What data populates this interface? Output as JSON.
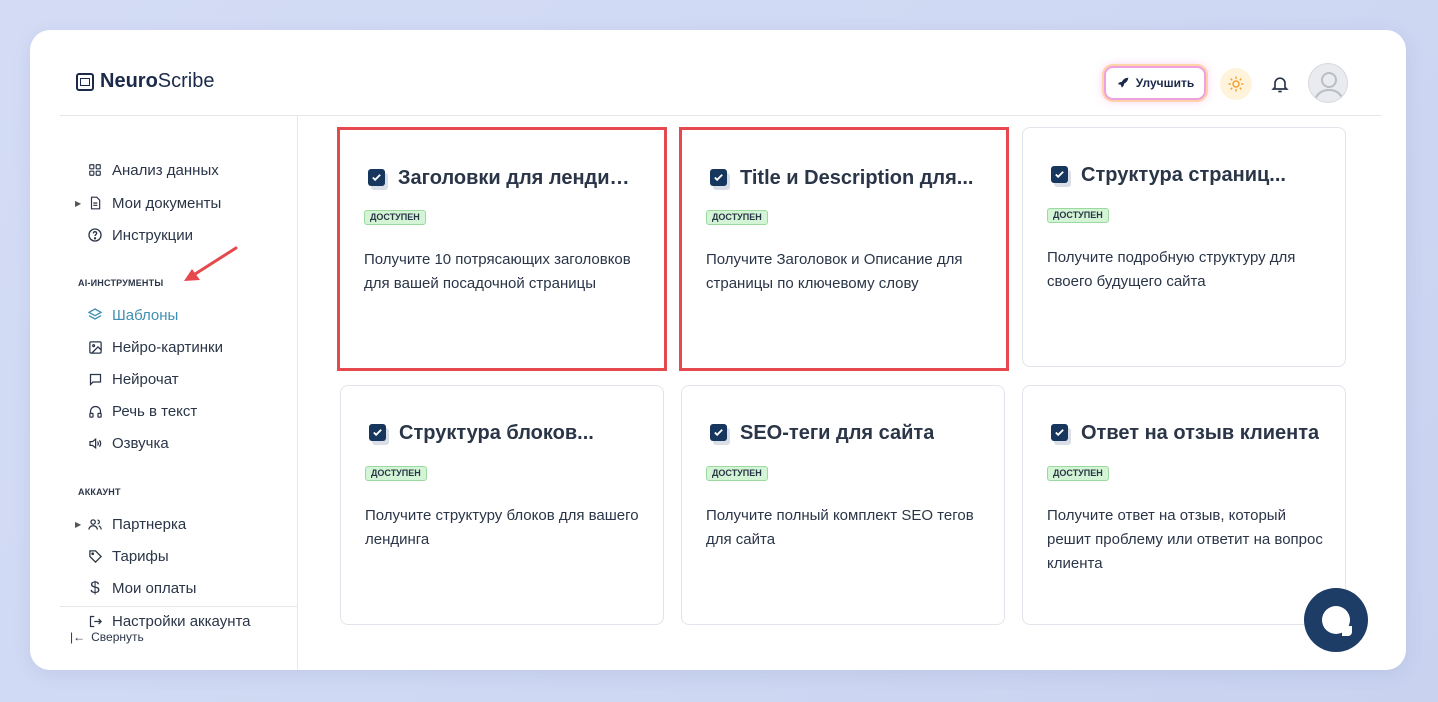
{
  "header": {
    "logo_bold": "Neuro",
    "logo_light": "Scribe",
    "upgrade_label": "Улучшить"
  },
  "sidebar": {
    "top_items": [
      {
        "label": "Анализ данных",
        "icon": "grid-icon"
      },
      {
        "label": "Мои документы",
        "icon": "document-icon"
      },
      {
        "label": "Инструкции",
        "icon": "help-circle-icon"
      }
    ],
    "section_ai": "AI-ИНСТРУМЕНТЫ",
    "ai_items": [
      {
        "label": "Шаблоны",
        "icon": "layers-icon",
        "active": true
      },
      {
        "label": "Нейро-картинки",
        "icon": "image-icon"
      },
      {
        "label": "Нейрочат",
        "icon": "chat-icon"
      },
      {
        "label": "Речь в текст",
        "icon": "headphones-icon"
      },
      {
        "label": "Озвучка",
        "icon": "speaker-icon"
      }
    ],
    "section_account": "АККАУНТ",
    "account_items": [
      {
        "label": "Партнерка",
        "icon": "users-icon"
      },
      {
        "label": "Тарифы",
        "icon": "tag-icon"
      },
      {
        "label": "Мои оплаты",
        "icon": "dollar-icon"
      },
      {
        "label": "Настройки аккаунта",
        "icon": "logout-icon"
      }
    ],
    "collapse_label": "Свернуть"
  },
  "cards": [
    {
      "title": "Заголовки для лендинга",
      "badge": "ДОСТУПЕН",
      "desc": "Получите 10 потрясающих заголовков для вашей посадочной страницы",
      "highlighted": true
    },
    {
      "title": "Title и Description для...",
      "badge": "ДОСТУПЕН",
      "desc": "Получите Заголовок и Описание для страницы по ключевому слову",
      "highlighted": true
    },
    {
      "title": "Структура страниц...",
      "badge": "ДОСТУПЕН",
      "desc": "Получите подробную структуру для своего будущего сайта",
      "highlighted": false
    },
    {
      "title": "Структура блоков...",
      "badge": "ДОСТУПЕН",
      "desc": "Получите структуру блоков для вашего лендинга",
      "highlighted": false
    },
    {
      "title": "SEO-теги для сайта",
      "badge": "ДОСТУПЕН",
      "desc": "Получите полный комплект SEO тегов для сайта",
      "highlighted": false
    },
    {
      "title": "Ответ на отзыв клиента",
      "badge": "ДОСТУПЕН",
      "desc": "Получите ответ на отзыв, который решит проблему или ответит на вопрос клиента",
      "highlighted": false
    }
  ],
  "colors": {
    "accent": "#3f8fb5",
    "highlight": "#e5484d",
    "badge_bg": "#d3f5d5",
    "check": "#17365e",
    "fab": "#1d3c66"
  }
}
